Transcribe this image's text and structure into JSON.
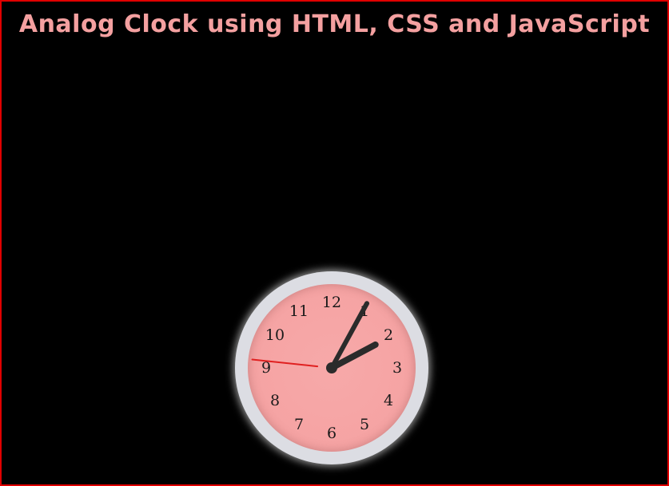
{
  "page": {
    "title": "Analog Clock using HTML, CSS and JavaScript"
  },
  "clock": {
    "numbers": [
      "12",
      "1",
      "2",
      "3",
      "4",
      "5",
      "6",
      "7",
      "8",
      "9",
      "10",
      "11"
    ],
    "time": {
      "hour": 2,
      "minute": 4,
      "second": 46
    },
    "colors": {
      "frame_border": "#e00000",
      "title": "#f4a0a0",
      "face": "#f5a3a3",
      "bezel": "#dcdde3",
      "hands": "#2b2b2b",
      "second_hand": "#e02020"
    }
  }
}
